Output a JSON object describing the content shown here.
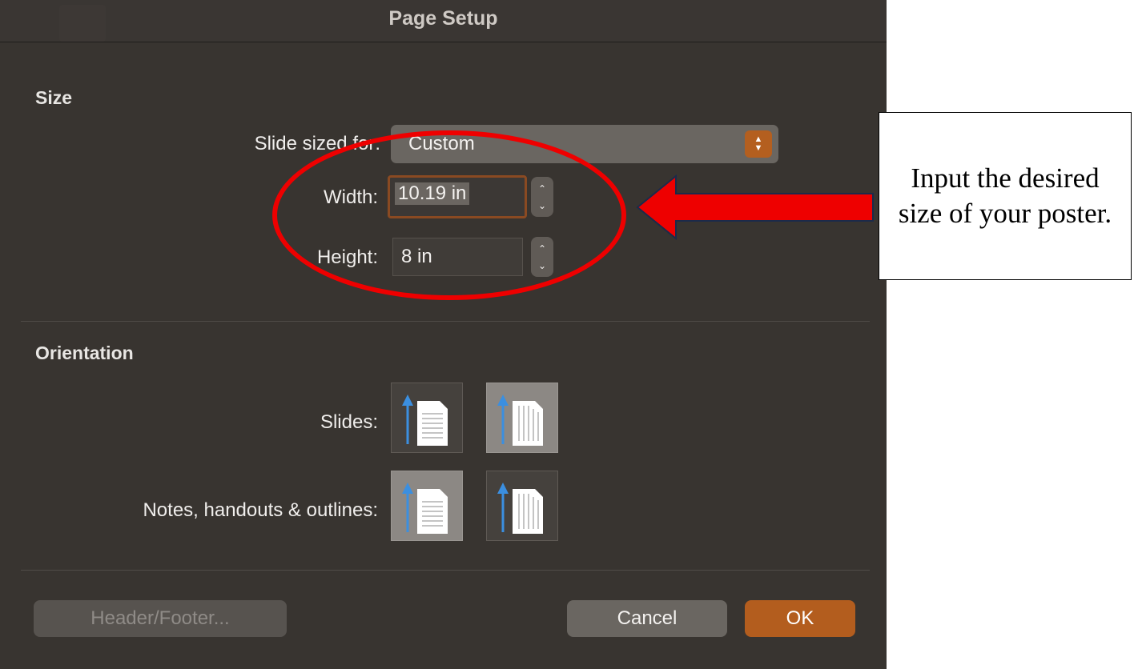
{
  "dialog": {
    "title": "Page Setup",
    "size": {
      "heading": "Size",
      "slide_sized_for_label": "Slide sized for:",
      "slide_sized_for_value": "Custom",
      "width_label": "Width:",
      "width_value": "10.19 in",
      "height_label": "Height:",
      "height_value": "8 in"
    },
    "orientation": {
      "heading": "Orientation",
      "slides_label": "Slides:",
      "notes_label": "Notes, handouts & outlines:",
      "slides_selected": "portrait",
      "notes_selected": "landscape"
    },
    "buttons": {
      "header_footer": "Header/Footer...",
      "cancel": "Cancel",
      "ok": "OK"
    }
  },
  "annotation": {
    "callout_text": "Input the desired size of your poster.",
    "highlight_color": "#ee0000"
  },
  "colors": {
    "dialog_bg": "#383430",
    "accent": "#b35d1e"
  }
}
